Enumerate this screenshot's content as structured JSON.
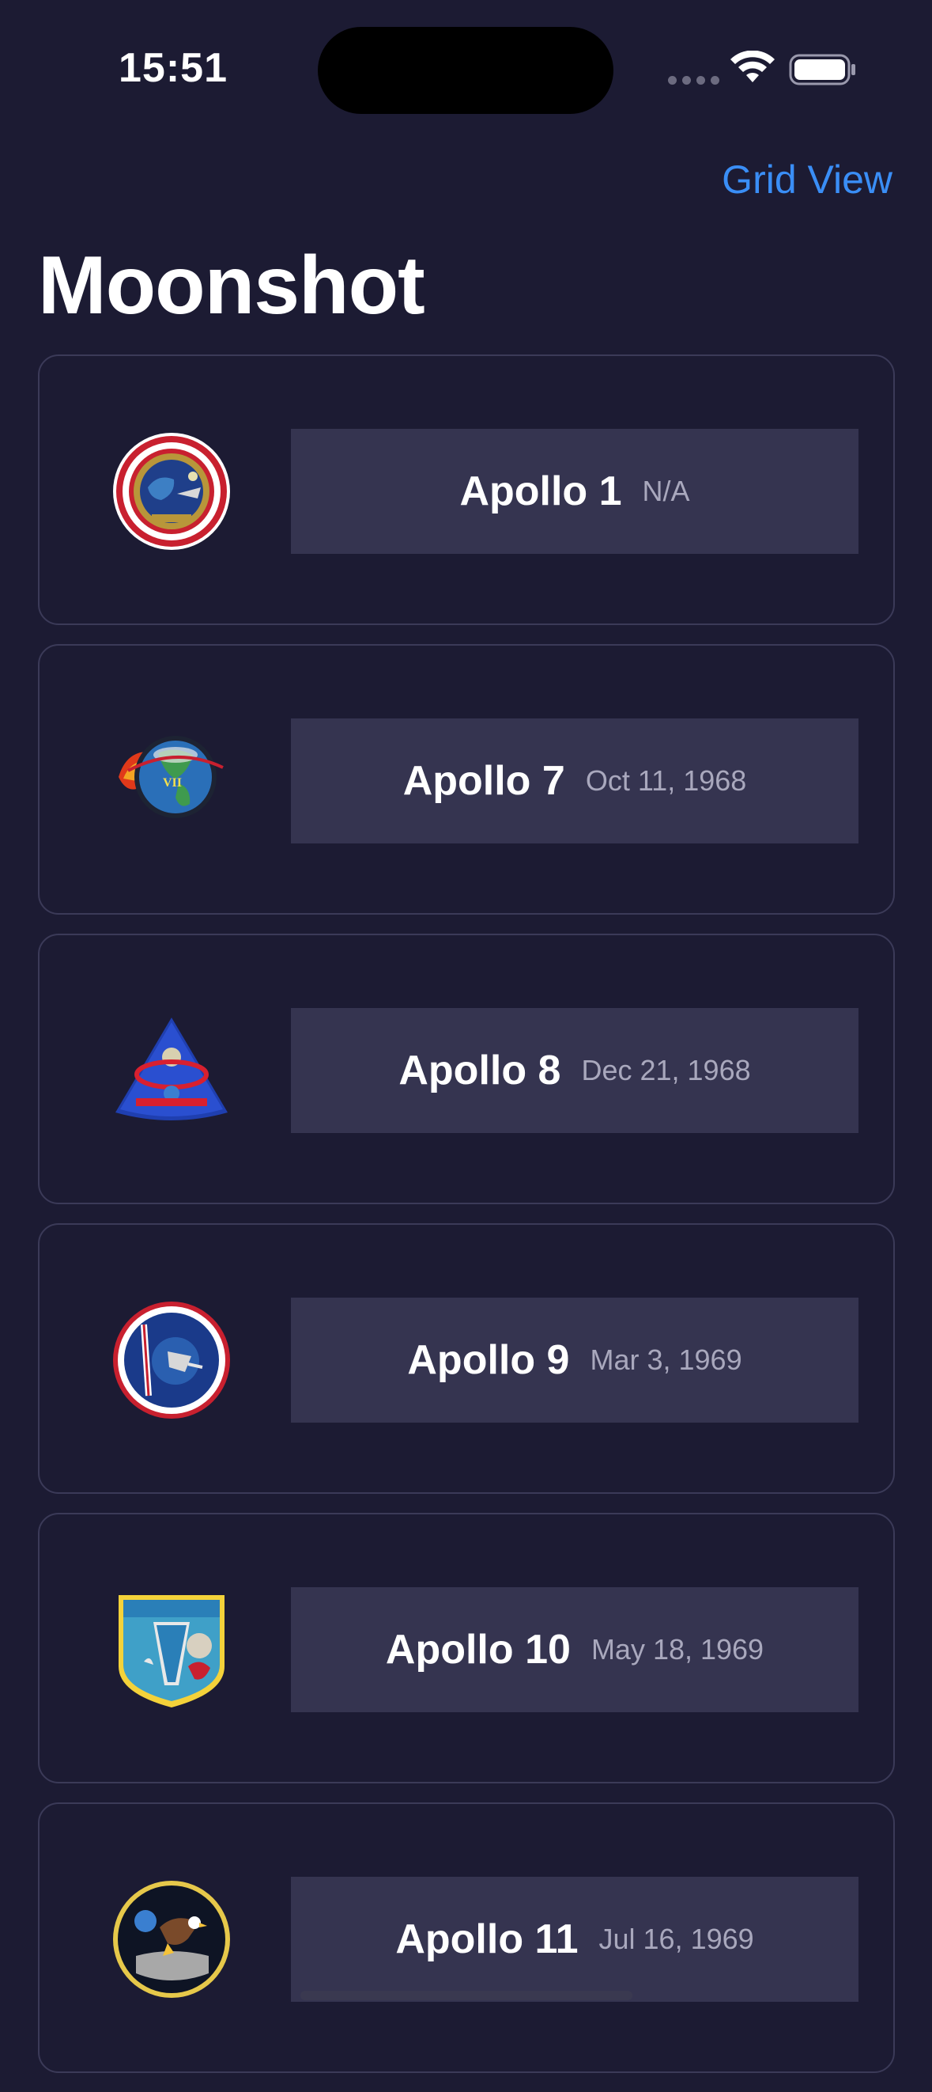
{
  "status_bar": {
    "time": "15:51"
  },
  "nav": {
    "grid_view_label": "Grid View",
    "title": "Moonshot"
  },
  "missions": [
    {
      "name": "Apollo 1",
      "date": "N/A",
      "badge": "apollo-1-patch-icon"
    },
    {
      "name": "Apollo 7",
      "date": "Oct 11, 1968",
      "badge": "apollo-7-patch-icon"
    },
    {
      "name": "Apollo 8",
      "date": "Dec 21, 1968",
      "badge": "apollo-8-patch-icon"
    },
    {
      "name": "Apollo 9",
      "date": "Mar 3, 1969",
      "badge": "apollo-9-patch-icon"
    },
    {
      "name": "Apollo 10",
      "date": "May 18, 1969",
      "badge": "apollo-10-patch-icon"
    },
    {
      "name": "Apollo 11",
      "date": "Jul 16, 1969",
      "badge": "apollo-11-patch-icon"
    }
  ],
  "colors": {
    "background": "#1c1b33",
    "card_label_bg": "#353450",
    "accent": "#3a8ef6",
    "secondary_text": "#a9a8bd"
  }
}
